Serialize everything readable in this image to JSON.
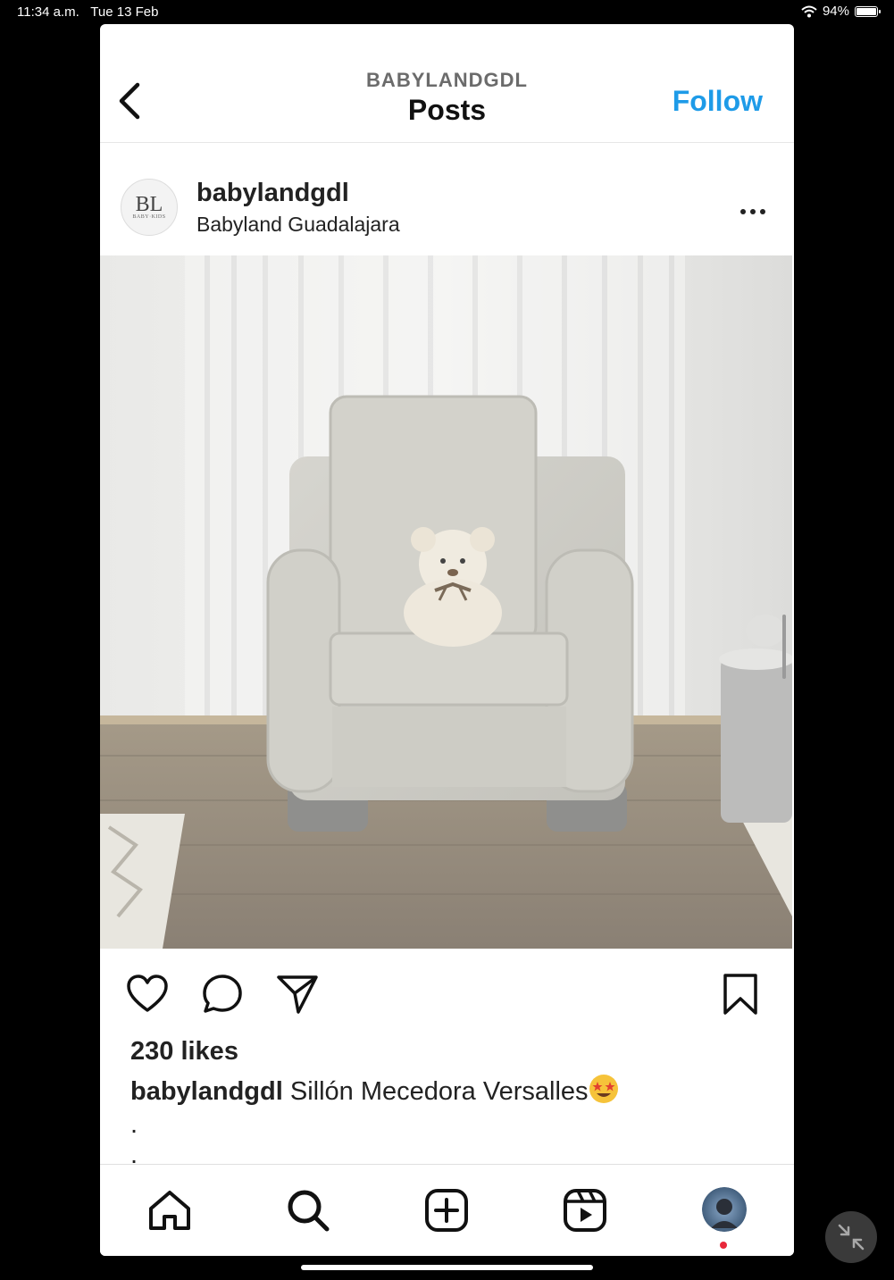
{
  "status": {
    "time": "11:34 a.m.",
    "date": "Tue 13 Feb",
    "battery": "94%"
  },
  "nav": {
    "username": "BABYLANDGDL",
    "title": "Posts",
    "follow_label": "Follow"
  },
  "post": {
    "username": "babylandgdl",
    "display_name": "Babyland Guadalajara",
    "likes": "230 likes",
    "caption_user": "babylandgdl",
    "caption_text": "Sillón Mecedora Versalles",
    "caption_lines": [
      ".",
      "."
    ]
  },
  "avatar_logo": {
    "monogram": "BL",
    "sub": "BABY·KIDS"
  },
  "colors": {
    "accent": "#1e9be8",
    "notification": "#e8283b"
  },
  "icons": {
    "nav": "chevron-left-icon",
    "post_actions": [
      "heart-icon",
      "comment-icon",
      "share-icon",
      "bookmark-icon"
    ],
    "tabs": [
      "home-icon",
      "search-icon",
      "create-icon",
      "reels-icon",
      "profile-avatar"
    ]
  }
}
